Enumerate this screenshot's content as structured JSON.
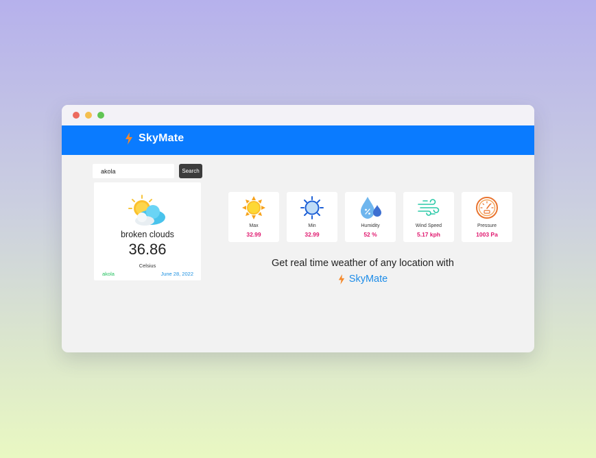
{
  "navbar": {
    "brand": "SkyMate",
    "brand_icon": "lightning-icon",
    "color": "#0a7bff"
  },
  "search": {
    "value": "akola",
    "button_label": "Search"
  },
  "weather": {
    "icon": "sun-behind-clouds-icon",
    "description": "broken clouds",
    "temperature": "36.86",
    "unit": "Celsius",
    "city": "akola",
    "date": "June 28, 2022"
  },
  "stats": [
    {
      "label": "Max",
      "value": "32.99",
      "icon": "sun-icon"
    },
    {
      "label": "Min",
      "value": "32.99",
      "icon": "sun-outline-icon"
    },
    {
      "label": "Humidity",
      "value": "52 %",
      "icon": "water-drops-icon"
    },
    {
      "label": "Wind Speed",
      "value": "5.17 kph",
      "icon": "wind-icon"
    },
    {
      "label": "Pressure",
      "value": "1003 Pa",
      "icon": "gauge-icon"
    }
  ],
  "promo": {
    "text": "Get real time weather of any location with",
    "brand": "SkyMate"
  },
  "colors": {
    "accent": "#0a7bff",
    "value": "#e0176e",
    "city": "#23c15f",
    "date": "#1a8fe0",
    "brand_text": "#1d8ce8"
  }
}
